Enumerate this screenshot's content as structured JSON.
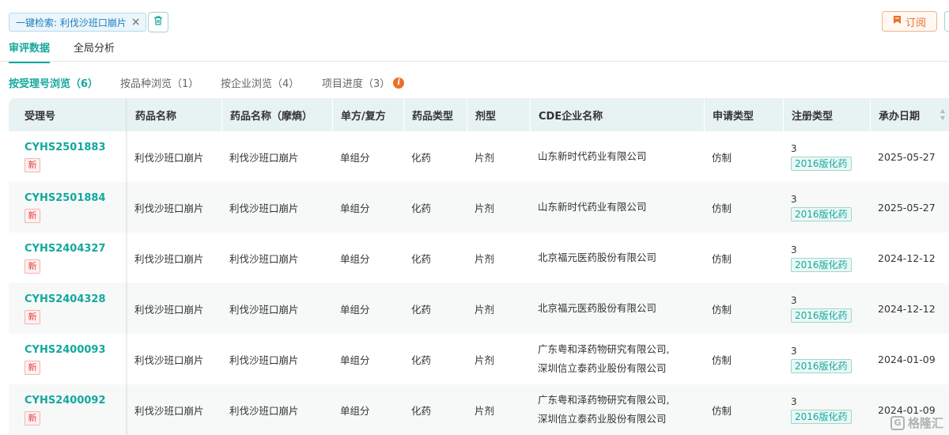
{
  "search_chip": {
    "label": "一键检索: 利伐沙班口崩片",
    "close": "×"
  },
  "subscribe_button": {
    "label": "订阅"
  },
  "main_tabs": [
    {
      "label": "审评数据",
      "active": true
    },
    {
      "label": "全局分析",
      "active": false
    }
  ],
  "sub_tabs": [
    {
      "label": "按受理号浏览（6）",
      "active": true
    },
    {
      "label": "按品种浏览（1）",
      "active": false
    },
    {
      "label": "按企业浏览（4）",
      "active": false
    },
    {
      "label": "项目进度（3）",
      "active": false
    }
  ],
  "table": {
    "columns": [
      "受理号",
      "药品名称",
      "药品名称（摩熵）",
      "单方/复方",
      "药品类型",
      "剂型",
      "CDE企业名称",
      "申请类型",
      "注册类型",
      "承办日期"
    ],
    "rows": [
      {
        "acceptance_no": "CYHS2501883",
        "new_tag": "新",
        "drug_name": "利伐沙班口崩片",
        "drug_name_moshang": "利伐沙班口崩片",
        "composition": "单组分",
        "drug_type": "化药",
        "dosage_form": "片剂",
        "company_line1": "山东新时代药业有限公司",
        "company_line2": "",
        "application_type": "仿制",
        "reg_num": "3",
        "reg_tag": "2016版化药",
        "date": "2025-05-27"
      },
      {
        "acceptance_no": "CYHS2501884",
        "new_tag": "新",
        "drug_name": "利伐沙班口崩片",
        "drug_name_moshang": "利伐沙班口崩片",
        "composition": "单组分",
        "drug_type": "化药",
        "dosage_form": "片剂",
        "company_line1": "山东新时代药业有限公司",
        "company_line2": "",
        "application_type": "仿制",
        "reg_num": "3",
        "reg_tag": "2016版化药",
        "date": "2025-05-27"
      },
      {
        "acceptance_no": "CYHS2404327",
        "new_tag": "新",
        "drug_name": "利伐沙班口崩片",
        "drug_name_moshang": "利伐沙班口崩片",
        "composition": "单组分",
        "drug_type": "化药",
        "dosage_form": "片剂",
        "company_line1": "北京福元医药股份有限公司",
        "company_line2": "",
        "application_type": "仿制",
        "reg_num": "3",
        "reg_tag": "2016版化药",
        "date": "2024-12-12"
      },
      {
        "acceptance_no": "CYHS2404328",
        "new_tag": "新",
        "drug_name": "利伐沙班口崩片",
        "drug_name_moshang": "利伐沙班口崩片",
        "composition": "单组分",
        "drug_type": "化药",
        "dosage_form": "片剂",
        "company_line1": "北京福元医药股份有限公司",
        "company_line2": "",
        "application_type": "仿制",
        "reg_num": "3",
        "reg_tag": "2016版化药",
        "date": "2024-12-12"
      },
      {
        "acceptance_no": "CYHS2400093",
        "new_tag": "新",
        "drug_name": "利伐沙班口崩片",
        "drug_name_moshang": "利伐沙班口崩片",
        "composition": "单组分",
        "drug_type": "化药",
        "dosage_form": "片剂",
        "company_line1": "广东粤和泽药物研究有限公司,",
        "company_line2": "深圳信立泰药业股份有限公司",
        "application_type": "仿制",
        "reg_num": "3",
        "reg_tag": "2016版化药",
        "date": "2024-01-09"
      },
      {
        "acceptance_no": "CYHS2400092",
        "new_tag": "新",
        "drug_name": "利伐沙班口崩片",
        "drug_name_moshang": "利伐沙班口崩片",
        "composition": "单组分",
        "drug_type": "化药",
        "dosage_form": "片剂",
        "company_line1": "广东粤和泽药物研究有限公司,",
        "company_line2": "深圳信立泰药业股份有限公司",
        "application_type": "仿制",
        "reg_num": "3",
        "reg_tag": "2016版化药",
        "date": "2024-01-09"
      }
    ]
  },
  "watermark": {
    "mark": "G",
    "text": "格隆汇"
  },
  "colors": {
    "accent": "#13a89e",
    "orange": "#e9702c",
    "new_red": "#e54040",
    "header_bg": "#e7f3f2"
  }
}
